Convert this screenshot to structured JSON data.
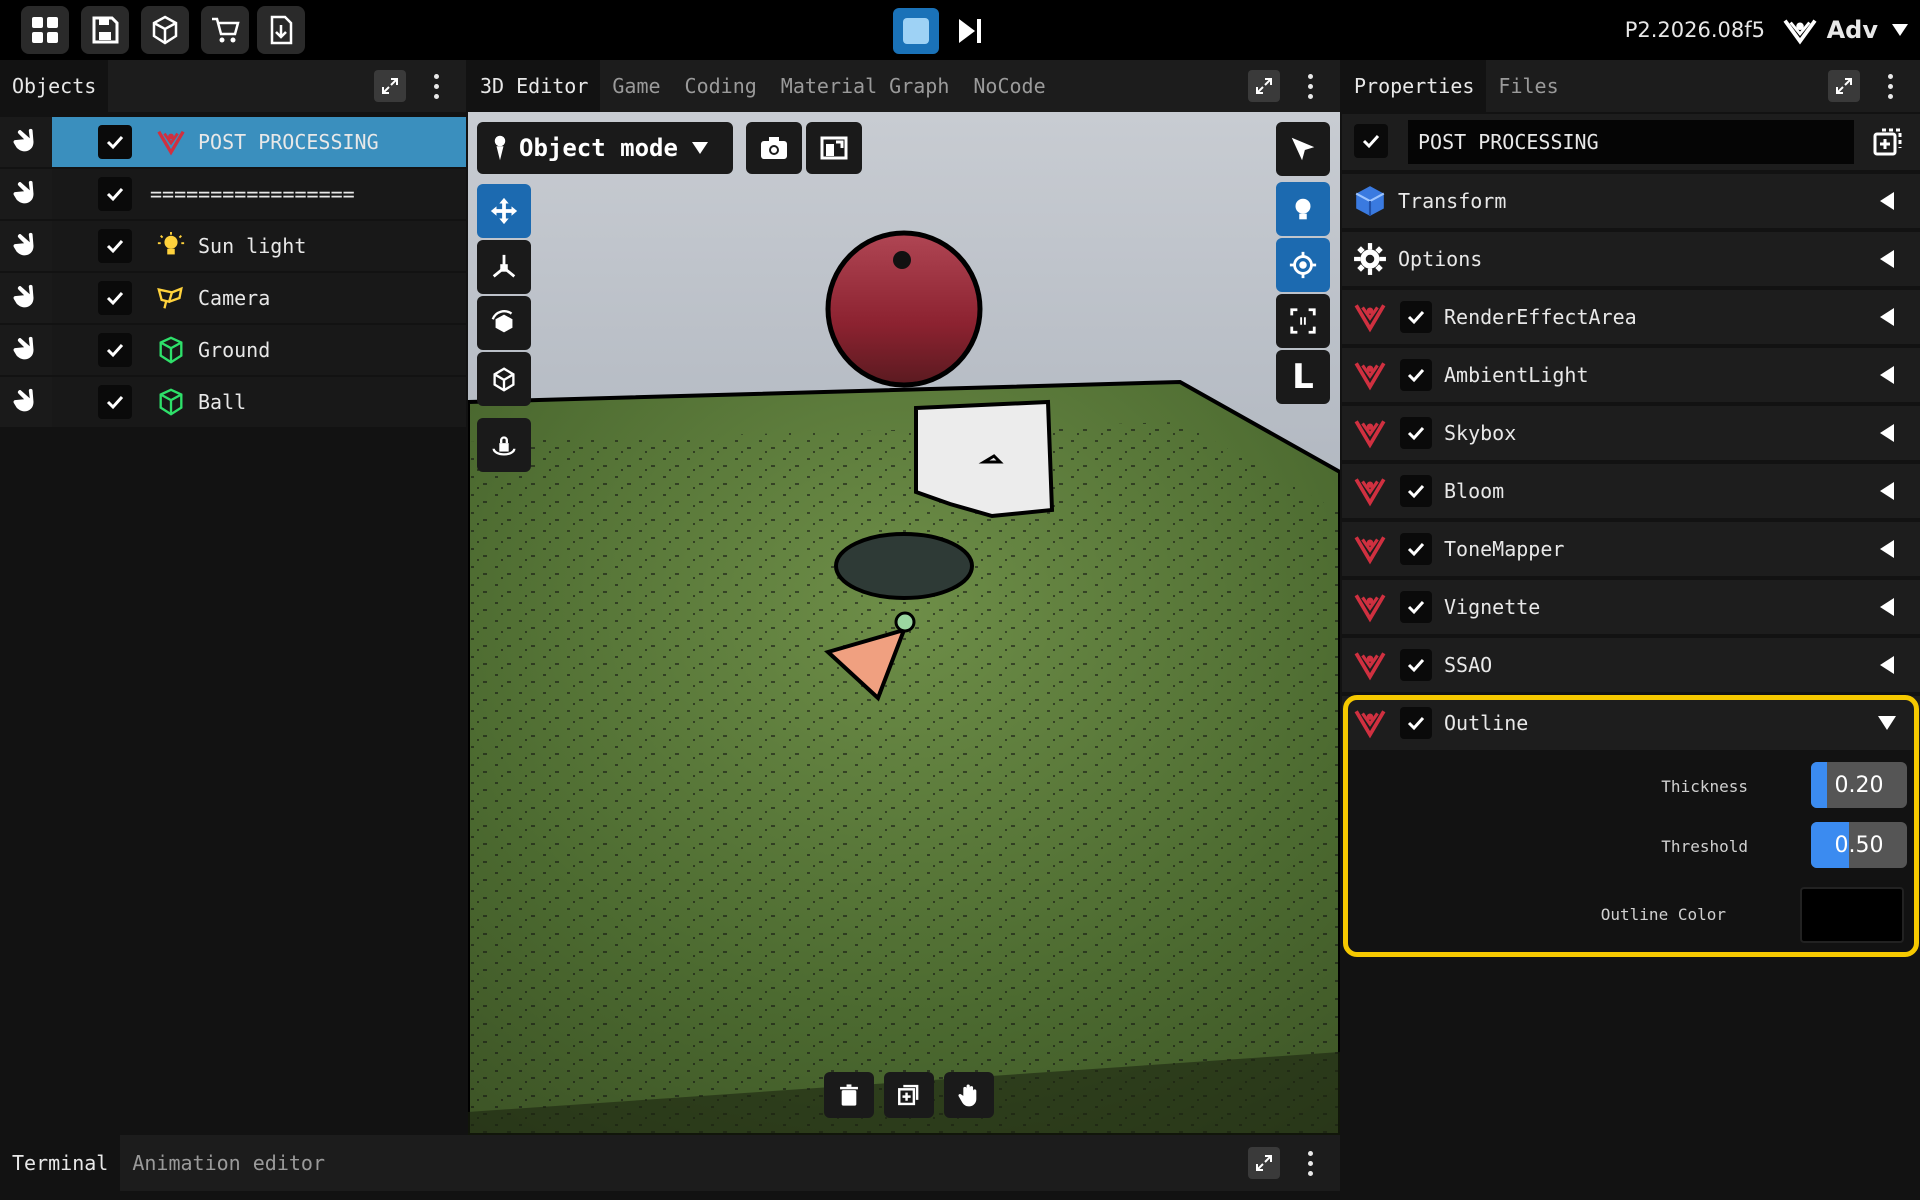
{
  "topbar": {
    "buttons": [
      "grid-icon",
      "save-icon",
      "cube-icon",
      "cart-icon",
      "download-icon"
    ],
    "version": "P2.2026.08f5",
    "user_label": "Adv"
  },
  "objects": {
    "tab": "Objects",
    "items": [
      {
        "label": "POST PROCESSING",
        "icon": "postprocess-icon",
        "checked": true,
        "selected": true
      },
      {
        "label": "=================",
        "icon": "",
        "checked": true,
        "selected": false
      },
      {
        "label": "Sun light",
        "icon": "bulb-icon",
        "checked": true,
        "selected": false
      },
      {
        "label": "Camera",
        "icon": "camera-icon",
        "checked": true,
        "selected": false
      },
      {
        "label": "Ground",
        "icon": "mesh-icon",
        "checked": true,
        "selected": false
      },
      {
        "label": "Ball",
        "icon": "mesh-icon",
        "checked": true,
        "selected": false
      }
    ]
  },
  "editor": {
    "tabs": [
      "3D Editor",
      "Game",
      "Coding",
      "Material Graph",
      "NoCode"
    ],
    "active_tab": "3D Editor",
    "mode": "Object mode",
    "orientation_label": "L"
  },
  "bottom": {
    "tabs": [
      "Terminal",
      "Animation editor"
    ]
  },
  "properties": {
    "tabs": [
      "Properties",
      "Files"
    ],
    "name_value": "POST PROCESSING",
    "sections": [
      {
        "label": "Transform",
        "icon": "cube-icon"
      },
      {
        "label": "Options",
        "icon": "gear-icon"
      }
    ],
    "components": [
      {
        "label": "RenderEffectArea"
      },
      {
        "label": "AmbientLight"
      },
      {
        "label": "Skybox"
      },
      {
        "label": "Bloom"
      },
      {
        "label": "ToneMapper"
      },
      {
        "label": "Vignette"
      },
      {
        "label": "SSAO"
      },
      {
        "label": "Outline",
        "expanded": true
      }
    ],
    "outline_fields": {
      "thickness_label": "Thickness",
      "thickness_value": "0.20",
      "thickness_fraction": 0.2,
      "threshold_label": "Threshold",
      "threshold_value": "0.50",
      "threshold_fraction": 0.5,
      "color_label": "Outline Color",
      "color_value": "#000000"
    }
  },
  "colors": {
    "accent": "#3a8fbe",
    "highlight": "#f6c900",
    "play": "#1a72b8"
  }
}
